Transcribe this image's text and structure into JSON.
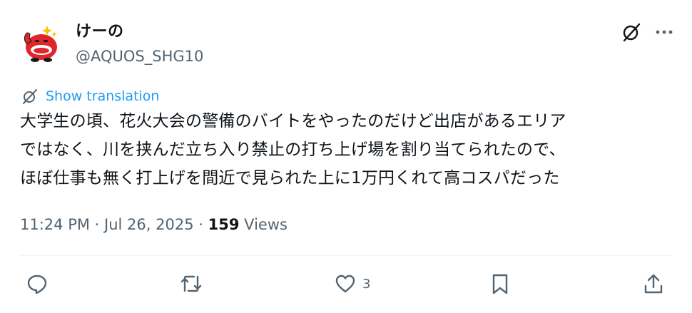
{
  "author": {
    "display_name": "けーの",
    "handle": "@AQUOS_SHG10"
  },
  "translation": {
    "label": "Show translation"
  },
  "tweet": {
    "text": "大学生の頃、花火大会の警備のバイトをやったのだけど出店があるエリア\nではなく、川を挟んだ立ち入り禁止の打ち上げ場を割り当てられたので、\nほぼ仕事も無く打上げを間近で見られた上に1万円くれて高コスパだった",
    "time": "11:24 PM",
    "separator": "·",
    "date": "Jul 26, 2025",
    "views_count": "159",
    "views_label": "Views"
  },
  "actions": {
    "reply_count": "",
    "retweet_count": "",
    "like_count": "3",
    "bookmark_count": ""
  },
  "icons": {
    "top": [
      "grok-icon",
      "more-icon"
    ],
    "translate": "translate-icon",
    "bar": [
      "reply-icon",
      "retweet-icon",
      "like-icon",
      "bookmark-icon",
      "share-icon"
    ]
  },
  "colors": {
    "accent": "#1d9bf0",
    "text": "#0f1419",
    "secondary": "#536471",
    "avatar_red": "#e0252b"
  }
}
